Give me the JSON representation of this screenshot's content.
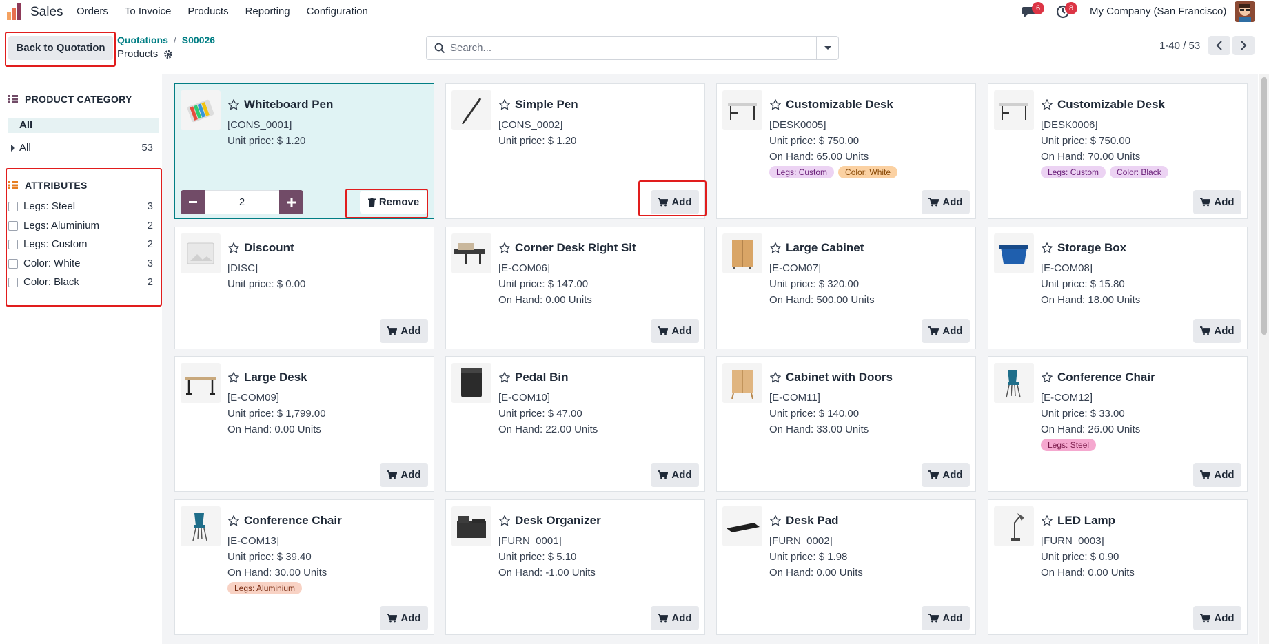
{
  "app": {
    "name": "Sales"
  },
  "menu": [
    "Orders",
    "To Invoice",
    "Products",
    "Reporting",
    "Configuration"
  ],
  "systray": {
    "messages_count": "6",
    "activity_count": "8",
    "company": "My Company (San Francisco)"
  },
  "control": {
    "back_label": "Back to Quotation",
    "breadcrumb": [
      "Quotations",
      "S00026"
    ],
    "current": "Products",
    "search_placeholder": "Search...",
    "pager": "1-40 / 53"
  },
  "sidebar": {
    "category_title": "PRODUCT CATEGORY",
    "active_category": "All",
    "categories": [
      {
        "label": "All",
        "count": "53"
      }
    ],
    "attributes_title": "ATTRIBUTES",
    "attributes": [
      {
        "label": "Legs: Steel",
        "count": "3"
      },
      {
        "label": "Legs: Aluminium",
        "count": "2"
      },
      {
        "label": "Legs: Custom",
        "count": "2"
      },
      {
        "label": "Color: White",
        "count": "3"
      },
      {
        "label": "Color: Black",
        "count": "2"
      }
    ]
  },
  "buttons": {
    "add": "Add",
    "remove": "Remove"
  },
  "products": [
    {
      "name": "Whiteboard Pen",
      "ref": "[CONS_0001]",
      "price": "Unit price: $ 1.20",
      "onhand": "",
      "tags": [],
      "selected": true,
      "qty": "2",
      "thumb": "pen-set-icon"
    },
    {
      "name": "Simple Pen",
      "ref": "[CONS_0002]",
      "price": "Unit price: $ 1.20",
      "onhand": "",
      "tags": [],
      "thumb": "pen-icon"
    },
    {
      "name": "Customizable Desk",
      "ref": "[DESK0005]",
      "price": "Unit price: $ 750.00",
      "onhand": "On Hand: 65.00 Units",
      "tags": [
        {
          "label": "Legs: Custom",
          "bg": "#ecd3f3",
          "fg": "#6b2179"
        },
        {
          "label": "Color: White",
          "bg": "#fbd1a2",
          "fg": "#8a4b08"
        }
      ],
      "thumb": "desk-icon"
    },
    {
      "name": "Customizable Desk",
      "ref": "[DESK0006]",
      "price": "Unit price: $ 750.00",
      "onhand": "On Hand: 70.00 Units",
      "tags": [
        {
          "label": "Legs: Custom",
          "bg": "#ecd3f3",
          "fg": "#6b2179"
        },
        {
          "label": "Color: Black",
          "bg": "#ecd3f3",
          "fg": "#6b2179"
        }
      ],
      "thumb": "desk-icon"
    },
    {
      "name": "Discount",
      "ref": "[DISC]",
      "price": "Unit price: $ 0.00",
      "onhand": "",
      "tags": [],
      "thumb": "placeholder-image-icon"
    },
    {
      "name": "Corner Desk Right Sit",
      "ref": "[E-COM06]",
      "price": "Unit price: $ 147.00",
      "onhand": "On Hand: 0.00 Units",
      "tags": [],
      "thumb": "corner-desk-icon"
    },
    {
      "name": "Large Cabinet",
      "ref": "[E-COM07]",
      "price": "Unit price: $ 320.00",
      "onhand": "On Hand: 500.00 Units",
      "tags": [],
      "thumb": "cabinet-icon"
    },
    {
      "name": "Storage Box",
      "ref": "[E-COM08]",
      "price": "Unit price: $ 15.80",
      "onhand": "On Hand: 18.00 Units",
      "tags": [],
      "thumb": "storage-box-icon"
    },
    {
      "name": "Large Desk",
      "ref": "[E-COM09]",
      "price": "Unit price: $ 1,799.00",
      "onhand": "On Hand: 0.00 Units",
      "tags": [],
      "thumb": "large-desk-icon"
    },
    {
      "name": "Pedal Bin",
      "ref": "[E-COM10]",
      "price": "Unit price: $ 47.00",
      "onhand": "On Hand: 22.00 Units",
      "tags": [],
      "thumb": "bin-icon"
    },
    {
      "name": "Cabinet with Doors",
      "ref": "[E-COM11]",
      "price": "Unit price: $ 140.00",
      "onhand": "On Hand: 33.00 Units",
      "tags": [],
      "thumb": "cabinet-doors-icon"
    },
    {
      "name": "Conference Chair",
      "ref": "[E-COM12]",
      "price": "Unit price: $ 33.00",
      "onhand": "On Hand: 26.00 Units",
      "tags": [
        {
          "label": "Legs: Steel",
          "bg": "#f5a8cf",
          "fg": "#7a1a4a"
        }
      ],
      "thumb": "chair-icon"
    },
    {
      "name": "Conference Chair",
      "ref": "[E-COM13]",
      "price": "Unit price: $ 39.40",
      "onhand": "On Hand: 30.00 Units",
      "tags": [
        {
          "label": "Legs: Aluminium",
          "bg": "#f8d2c4",
          "fg": "#7a2e14"
        }
      ],
      "thumb": "chair-icon"
    },
    {
      "name": "Desk Organizer",
      "ref": "[FURN_0001]",
      "price": "Unit price: $ 5.10",
      "onhand": "On Hand: -1.00 Units",
      "tags": [],
      "thumb": "organizer-icon"
    },
    {
      "name": "Desk Pad",
      "ref": "[FURN_0002]",
      "price": "Unit price: $ 1.98",
      "onhand": "On Hand: 0.00 Units",
      "tags": [],
      "thumb": "desk-pad-icon"
    },
    {
      "name": "LED Lamp",
      "ref": "[FURN_0003]",
      "price": "Unit price: $ 0.90",
      "onhand": "On Hand: 0.00 Units",
      "tags": [],
      "thumb": "lamp-icon"
    }
  ]
}
